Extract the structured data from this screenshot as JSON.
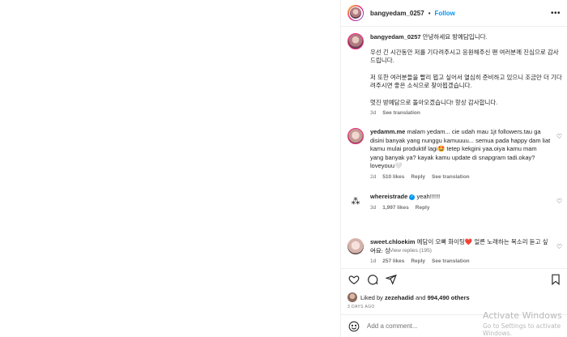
{
  "post": {
    "username": "bangyedam_0257",
    "follow_label": "Follow",
    "separator": "•",
    "more_label": "•••"
  },
  "caption": {
    "username": "bangyedam_0257",
    "line1": "안녕하세요 방예담입니다.",
    "line2": "우선 긴 시간동안 저를 기다려주시고 응원해주신 팬 여러분께 진심으로 감사드립니다.",
    "line3": "저 또한 여러분들을 빨리 뵙고 싶어서 열심히 준비하고 있으니 조금만 더 기다려주시면 좋은 소식으로 찾아뵙겠습니다.",
    "line4": "멋진 방예담으로 돌아오겠습니다! 항상 감사합니다.",
    "time": "3d",
    "translation": "See translation"
  },
  "comments": [
    {
      "username": "yedamm.me",
      "text": "malam yedam... cie udah mau 1jt followers.tau ga disini banyak yang nunggu kamuuuu... semua pada happy dam liat kamu mulai produktif lagi🤩 tetep kekgini yaa.oiya kamu mam yang banyak ya? kayak kamu update di snapgram tadi.okay?loveyouu🤍",
      "time": "2d",
      "likes": "510 likes",
      "reply": "Reply",
      "translation": "See translation"
    },
    {
      "username": "whereistrade",
      "text": "yeah!!!!!!",
      "time": "3d",
      "likes": "1,997 likes",
      "reply": "Reply",
      "view_replies": "View replies (195)"
    },
    {
      "username": "sweet.chloekim",
      "text": "예담이 오빠 화이팅❤️ 얼른 노래하는 목소리 듣고 싶어요. 싱",
      "time": "1d",
      "likes": "257 likes",
      "reply": "Reply",
      "translation": "See translation"
    }
  ],
  "actions": {
    "liked_by_prefix": "Liked by",
    "liked_by_user": "zezehadid",
    "and": "and",
    "others": "994,490 others",
    "date": "3 DAYS AGO"
  },
  "add_comment": {
    "placeholder": "Add a comment..."
  },
  "watermark": {
    "title": "Activate Windows",
    "subtitle": "Go to Settings to activate Windows."
  }
}
